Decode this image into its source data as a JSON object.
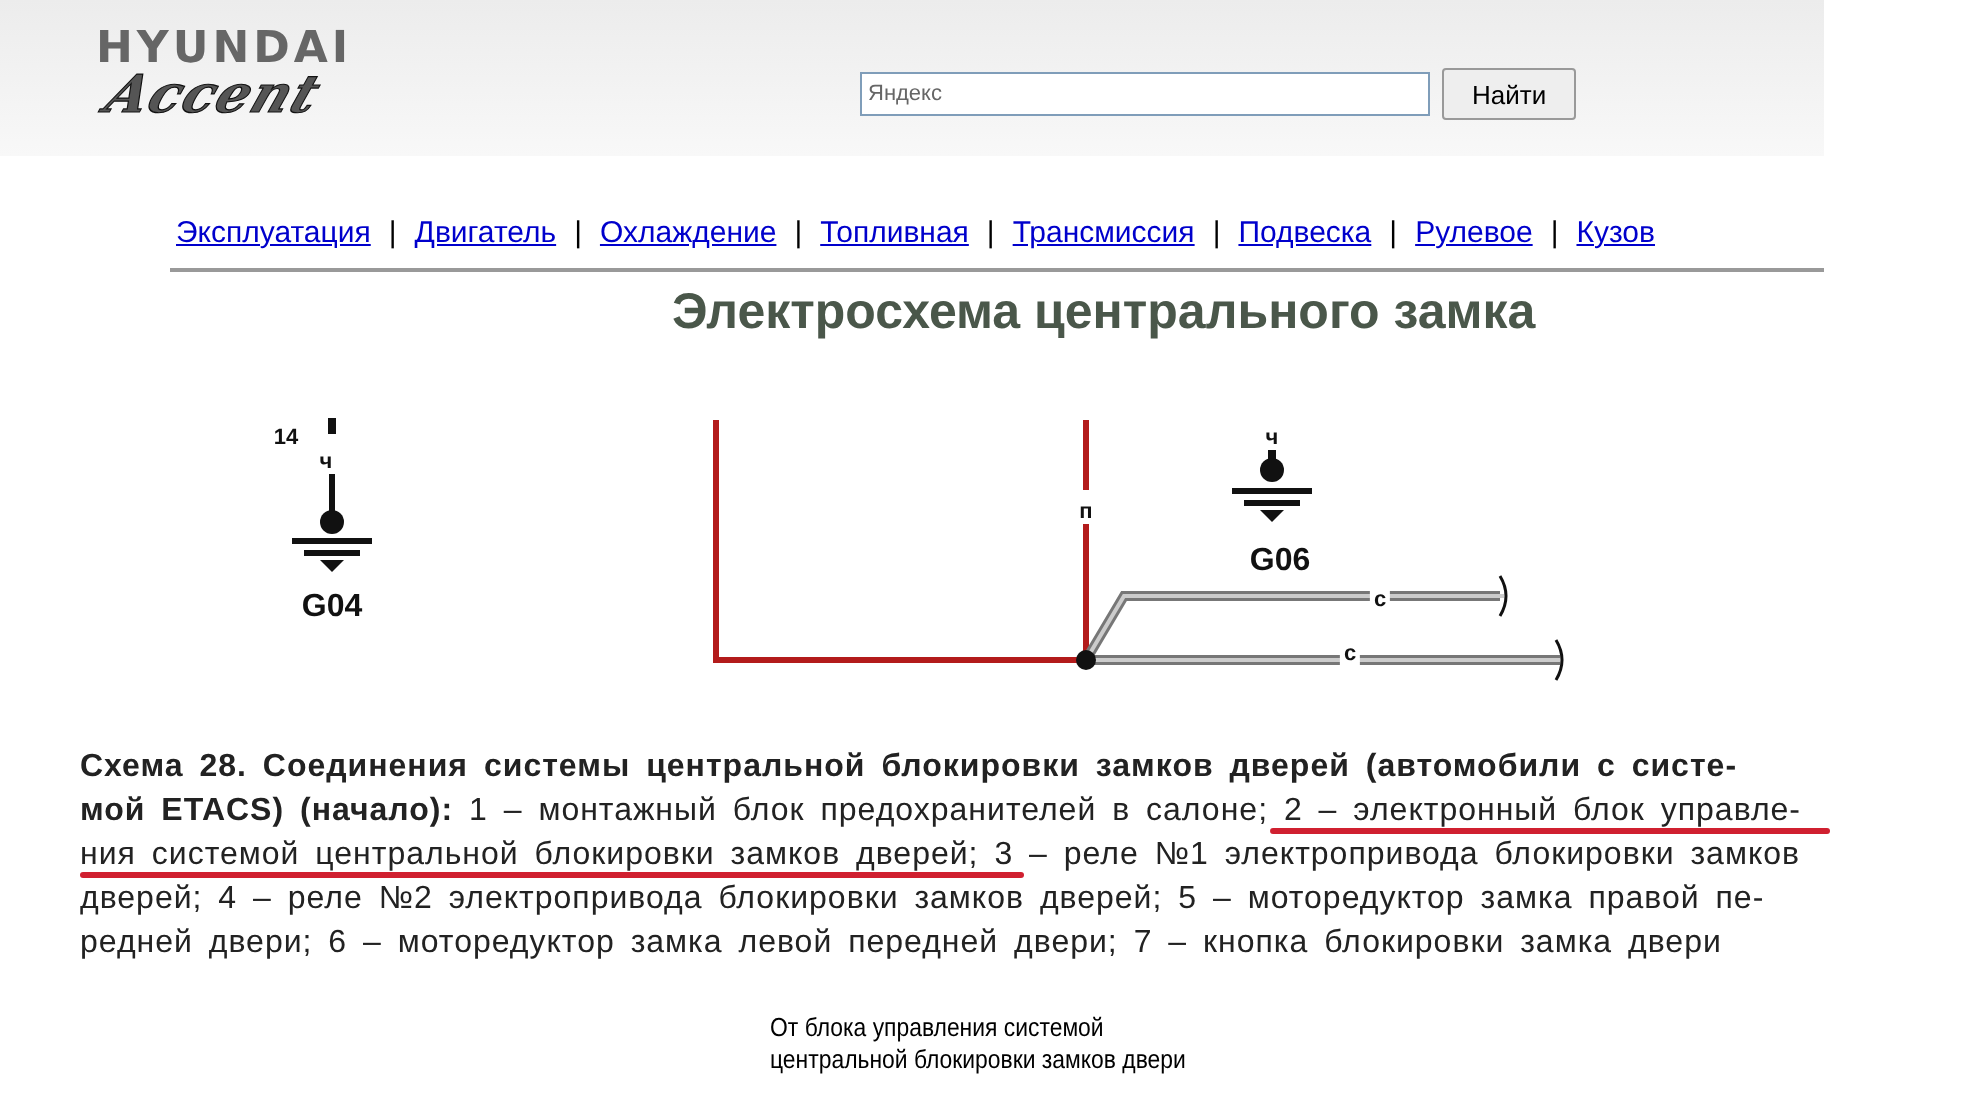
{
  "header": {
    "brand": "HYUNDAI",
    "model": "Accent",
    "search": {
      "value": "Яндекс"
    },
    "search_button": "Найти"
  },
  "nav": {
    "links": [
      "Эксплуатация",
      "Двигатель",
      "Охлаждение",
      "Топливная",
      "Трансмиссия",
      "Подвеска",
      "Рулевое",
      "Кузов"
    ],
    "separators": [
      "|",
      "|",
      "|",
      "|",
      "|",
      "|",
      "|"
    ]
  },
  "title": "Электросхема центрального замка",
  "diagram": {
    "labels": [
      {
        "kind": "pin",
        "text": "14"
      },
      {
        "kind": "wire",
        "text": "ч"
      },
      {
        "kind": "ground",
        "text": "G04"
      },
      {
        "kind": "wire",
        "text": "п"
      },
      {
        "kind": "wire",
        "text": "ч"
      },
      {
        "kind": "ground",
        "text": "G06"
      },
      {
        "kind": "wire",
        "text": "с"
      },
      {
        "kind": "wire",
        "text": "с"
      }
    ]
  },
  "caption": {
    "lines": [
      {
        "text": "Схема 28. Соединения системы центральной блокировки замков дверей (автомобили с систе-",
        "bold": true
      },
      {
        "text": "**мой ETACS) (начало):** 1 – монтажный блок предохранителей в салоне; 2 – электронный блок управле-",
        "bold": false
      },
      {
        "text": "ния системой центральной блокировки замков дверей; 3 – реле №1 электропривода блокировки замков",
        "bold": false
      },
      {
        "text": "дверей; 4 – реле №2 электропривода блокировки замков дверей; 5 – моторедуктор замка правой пе-",
        "bold": false
      },
      {
        "text": "редней двери; 6 – моторедуктор замка левой передней двери; 7 – кнопка блокировки замка двери",
        "bold": false
      }
    ]
  },
  "note": [
    "От блока управления системой",
    "центральной блокировки замков двери"
  ]
}
